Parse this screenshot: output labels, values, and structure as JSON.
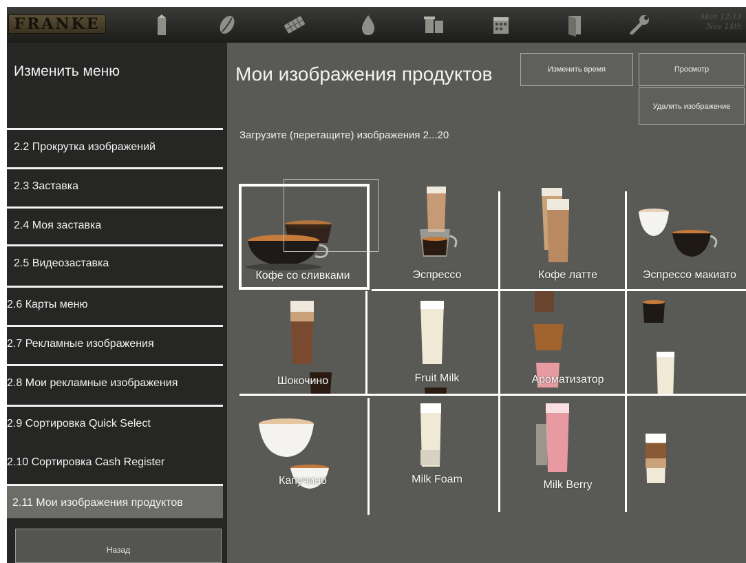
{
  "topbar": {
    "logo_text": "FRANKE",
    "icons": [
      "milk-carton-icon",
      "coffee-bean-icon",
      "chocolate-icon",
      "water-drop-icon",
      "cups-icon",
      "calendar-icon",
      "door-icon",
      "wrench-icon"
    ],
    "clock_line1": "Mon 12:11",
    "clock_line2": "Nov 14th"
  },
  "sidebar": {
    "title": "Изменить меню",
    "items": [
      {
        "label": "2.2 Прокрутка изображений"
      },
      {
        "label": "2.3 Заставка"
      },
      {
        "label": "2.4 Моя заставка"
      },
      {
        "label": "2.5 Видеозаставка"
      },
      {
        "label": "2.6 Карты меню"
      },
      {
        "label": "2.7 Рекламные изображения"
      },
      {
        "label": "2.8 Мои рекламные изображения"
      },
      {
        "label": "2.9 Сортировка Quick Select"
      },
      {
        "label": "2.10 Сортировка Cash Register"
      },
      {
        "label": "2.11 Мои изображения продуктов"
      }
    ],
    "active_item": "2.11 Мои изображения продуктов",
    "back_label": "Назад"
  },
  "main": {
    "title": "Мои изображения продуктов",
    "change_time_label": "Изменить время",
    "preview_label": "Просмотр",
    "delete_image_label": "Удалить изображение",
    "upload_hint": "Загрузите (перетащите) изображения 2...20"
  },
  "products": [
    {
      "label": "Кофе со сливками",
      "icon": "cup-icon"
    },
    {
      "label": "Эспрессо",
      "icon": "glass-icon"
    },
    {
      "label": "Кофе латте",
      "icon": "glass-icon"
    },
    {
      "label": "Эспрессо макиато",
      "icon": "cup-icon"
    },
    {
      "label": "Шокочино",
      "icon": "glass-icon"
    },
    {
      "label": "Fruit Milk",
      "icon": "glass-icon"
    },
    {
      "label": "Ароматизатор",
      "icon": "glass-icon"
    },
    {
      "label": "",
      "icon": "glass-icon"
    },
    {
      "label": "Капучино",
      "icon": "cup-icon"
    },
    {
      "label": "Milk Foam",
      "icon": "glass-icon"
    },
    {
      "label": "Milk Berry",
      "icon": "glass-icon"
    },
    {
      "label": "",
      "icon": "glass-icon"
    }
  ],
  "selected_product": "Кофе со сливками",
  "colors": {
    "background": "#595a56",
    "sidebar": "#262624",
    "active_item": "#6c6c69",
    "coffee": "#2a1a10",
    "crema": "#c77b3a",
    "milk": "#f2ede0",
    "berry": "#e79aa2"
  }
}
